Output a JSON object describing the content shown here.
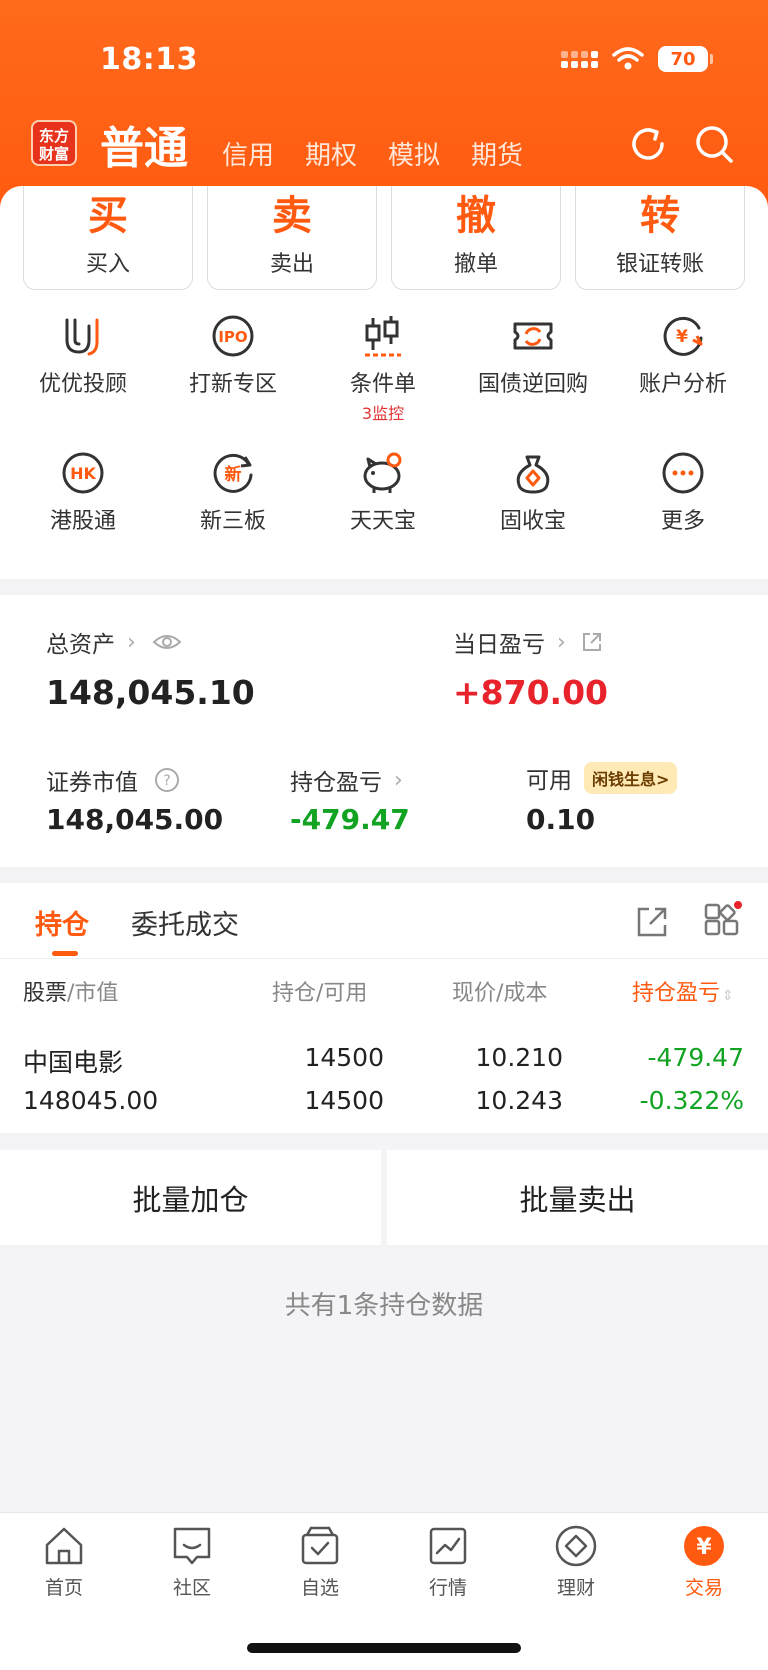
{
  "status": {
    "time": "18:13",
    "battery": "70"
  },
  "header": {
    "logo": [
      "东方",
      "财富"
    ],
    "tabs": [
      "普通",
      "信用",
      "期权",
      "模拟",
      "期货"
    ]
  },
  "trade_buttons": [
    {
      "big": "买",
      "small": "买入"
    },
    {
      "big": "卖",
      "small": "卖出"
    },
    {
      "big": "撤",
      "small": "撤单"
    },
    {
      "big": "转",
      "small": "银证转账"
    }
  ],
  "grid_row1": [
    {
      "label": "优优投顾",
      "icon": "uu-advisor-icon"
    },
    {
      "label": "打新专区",
      "icon": "ipo-icon"
    },
    {
      "label": "条件单",
      "sub": "3监控",
      "icon": "condition-order-icon"
    },
    {
      "label": "国债逆回购",
      "icon": "repo-icon"
    },
    {
      "label": "账户分析",
      "icon": "account-analysis-icon"
    }
  ],
  "grid_row2": [
    {
      "label": "港股通",
      "icon": "hk-icon"
    },
    {
      "label": "新三板",
      "icon": "neeq-icon"
    },
    {
      "label": "天天宝",
      "icon": "piggy-icon"
    },
    {
      "label": "固收宝",
      "icon": "money-bag-icon"
    },
    {
      "label": "更多",
      "icon": "more-icon"
    }
  ],
  "assets": {
    "total_label": "总资产",
    "total_value": "148,045.10",
    "daily_label": "当日盈亏",
    "daily_value": "+870.00",
    "market_label": "证券市值",
    "market_value": "148,045.00",
    "position_pl_label": "持仓盈亏",
    "position_pl_value": "-479.47",
    "available_label": "可用",
    "available_badge": "闲钱生息>",
    "available_value": "0.10"
  },
  "positions": {
    "tabs": [
      "持仓",
      "委托成交"
    ],
    "headers": {
      "col1a": "股票",
      "col1b": "/市值",
      "col2a": "持仓",
      "col2b": "/可用",
      "col3a": "现价",
      "col3b": "/成本",
      "col4": "持仓盈亏"
    },
    "rows": [
      {
        "name": "中国电影",
        "market_value": "148045.00",
        "holding": "14500",
        "available": "14500",
        "price": "10.210",
        "cost": "10.243",
        "pl": "-479.47",
        "pl_pct": "-0.322%"
      }
    ]
  },
  "batch": {
    "add": "批量加仓",
    "sell": "批量卖出"
  },
  "footer_note": "共有1条持仓数据",
  "tabbar": [
    "首页",
    "社区",
    "自选",
    "行情",
    "理财",
    "交易"
  ],
  "colors": {
    "accent": "#ff5a10",
    "up": "#e8232b",
    "down": "#12a322"
  }
}
